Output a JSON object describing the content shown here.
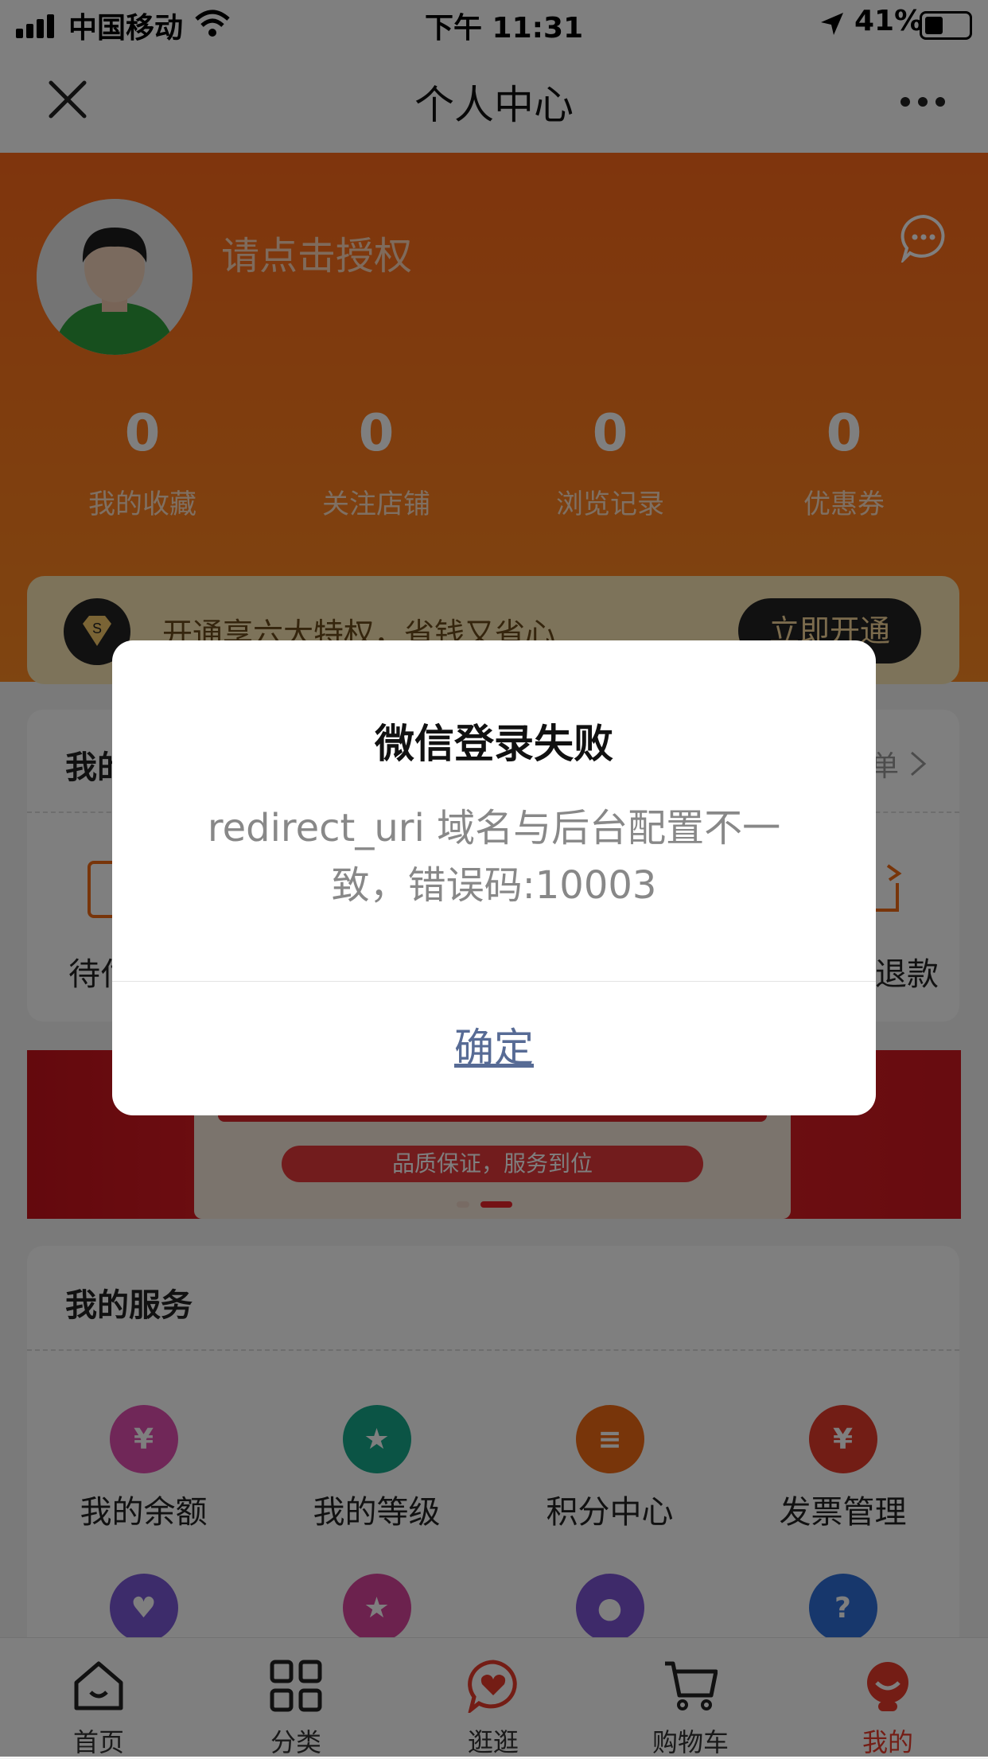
{
  "status_bar": {
    "carrier": "中国移动",
    "time": "下午 11:31",
    "battery": "41%"
  },
  "nav": {
    "title": "个人中心"
  },
  "profile": {
    "auth_prompt": "请点击授权"
  },
  "stats": [
    {
      "value": "0",
      "label": "我的收藏"
    },
    {
      "value": "0",
      "label": "关注店铺"
    },
    {
      "value": "0",
      "label": "浏览记录"
    },
    {
      "value": "0",
      "label": "优惠券"
    }
  ],
  "vip": {
    "text": "开通享六大特权，省钱又省心",
    "button": "立即开通"
  },
  "orders": {
    "title": "我的",
    "first_label": "待付",
    "last_label": "退款",
    "more": "单"
  },
  "services": {
    "title": "我的服务",
    "items": [
      {
        "label": "我的余额",
        "icon": "money-bag-icon",
        "color": "#e04fb0"
      },
      {
        "label": "我的等级",
        "icon": "medal-icon",
        "color": "#16a88a"
      },
      {
        "label": "积分中心",
        "icon": "coins-icon",
        "color": "#f06a14"
      },
      {
        "label": "发票管理",
        "icon": "invoice-icon",
        "color": "#e53b2b"
      }
    ],
    "row2_icons": [
      {
        "icon": "heart-icon",
        "color": "#7b58d6"
      },
      {
        "icon": "star-icon",
        "color": "#d9459c"
      },
      {
        "icon": "footprint-icon",
        "color": "#7c55d4"
      },
      {
        "icon": "question-icon",
        "color": "#2f6fd8"
      }
    ]
  },
  "banner": {
    "subtitle": "品质保证，服务到位"
  },
  "tabbar": [
    {
      "label": "首页",
      "icon": "home-icon"
    },
    {
      "label": "分类",
      "icon": "grid-icon"
    },
    {
      "label": "逛逛",
      "icon": "chat-heart-icon"
    },
    {
      "label": "购物车",
      "icon": "cart-icon"
    },
    {
      "label": "我的",
      "icon": "profile-icon"
    }
  ],
  "dialog": {
    "title": "微信登录失败",
    "message": "redirect_uri 域名与后台配置不一致，错误码:10003",
    "confirm": "确定"
  }
}
